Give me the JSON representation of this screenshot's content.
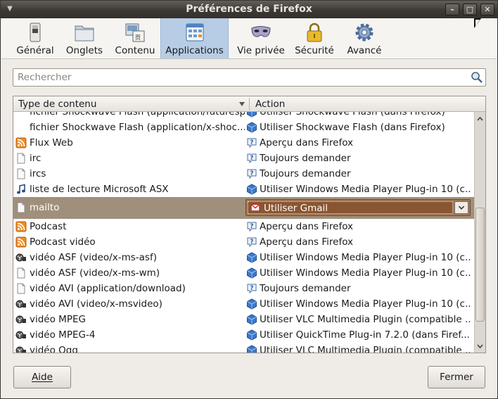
{
  "window": {
    "title": "Préférences de Firefox"
  },
  "toolbar": {
    "items": [
      {
        "label": "Général",
        "icon": "general-switch-icon"
      },
      {
        "label": "Onglets",
        "icon": "tabs-folder-icon"
      },
      {
        "label": "Contenu",
        "icon": "content-icon"
      },
      {
        "label": "Applications",
        "icon": "applications-icon",
        "active": true
      },
      {
        "label": "Vie privée",
        "icon": "privacy-mask-icon"
      },
      {
        "label": "Sécurité",
        "icon": "security-lock-icon"
      },
      {
        "label": "Avancé",
        "icon": "advanced-gear-icon"
      }
    ]
  },
  "search": {
    "placeholder": "Rechercher"
  },
  "table": {
    "columns": [
      "Type de contenu",
      "Action"
    ],
    "rows": [
      {
        "type": "fichier Shockwave Flash (application/futuresplash)",
        "type_icon": "none",
        "action": "Utiliser Shockwave Flash (dans Firefox)",
        "action_icon": "plugin-icon"
      },
      {
        "type": "fichier Shockwave Flash (application/x-shoc...",
        "type_icon": "none",
        "action": "Utiliser Shockwave Flash (dans Firefox)",
        "action_icon": "plugin-icon"
      },
      {
        "type": "Flux Web",
        "type_icon": "rss-icon",
        "action": "Aperçu dans Firefox",
        "action_icon": "ask-icon"
      },
      {
        "type": "irc",
        "type_icon": "file-icon",
        "action": "Toujours demander",
        "action_icon": "ask-icon"
      },
      {
        "type": "ircs",
        "type_icon": "file-icon",
        "action": "Toujours demander",
        "action_icon": "ask-icon"
      },
      {
        "type": "liste de lecture Microsoft ASX",
        "type_icon": "music-note-icon",
        "action": "Utiliser Windows Media Player Plug-in 10 (c...",
        "action_icon": "plugin-icon"
      },
      {
        "type": "mailto",
        "type_icon": "file-icon",
        "action": "Utiliser Gmail",
        "action_icon": "gmail-icon",
        "selected": true
      },
      {
        "type": "Podcast",
        "type_icon": "rss-icon",
        "action": "Aperçu dans Firefox",
        "action_icon": "ask-icon"
      },
      {
        "type": "Podcast vidéo",
        "type_icon": "rss-icon",
        "action": "Aperçu dans Firefox",
        "action_icon": "ask-icon"
      },
      {
        "type": "vidéo ASF (video/x-ms-asf)",
        "type_icon": "film-reel-icon",
        "action": "Utiliser Windows Media Player Plug-in 10 (c...",
        "action_icon": "plugin-icon"
      },
      {
        "type": "vidéo ASF (video/x-ms-wm)",
        "type_icon": "file-icon",
        "action": "Utiliser Windows Media Player Plug-in 10 (c...",
        "action_icon": "plugin-icon"
      },
      {
        "type": "vidéo AVI (application/download)",
        "type_icon": "file-icon",
        "action": "Toujours demander",
        "action_icon": "ask-icon"
      },
      {
        "type": "vidéo AVI (video/x-msvideo)",
        "type_icon": "film-reel-icon",
        "action": "Utiliser Windows Media Player Plug-in 10 (c...",
        "action_icon": "plugin-icon"
      },
      {
        "type": "vidéo MPEG",
        "type_icon": "film-reel-icon",
        "action": "Utiliser VLC Multimedia Plugin (compatible ...",
        "action_icon": "plugin-icon"
      },
      {
        "type": "vidéo MPEG-4",
        "type_icon": "film-reel-icon",
        "action": "Utiliser QuickTime Plug-in 7.2.0 (dans Firef...",
        "action_icon": "plugin-icon"
      },
      {
        "type": "vidéo Ogg",
        "type_icon": "film-reel-icon",
        "action": "Utiliser VLC Multimedia Plugin (compatible ...",
        "action_icon": "plugin-icon"
      }
    ]
  },
  "buttons": {
    "help": "Aide",
    "close": "Fermer"
  }
}
